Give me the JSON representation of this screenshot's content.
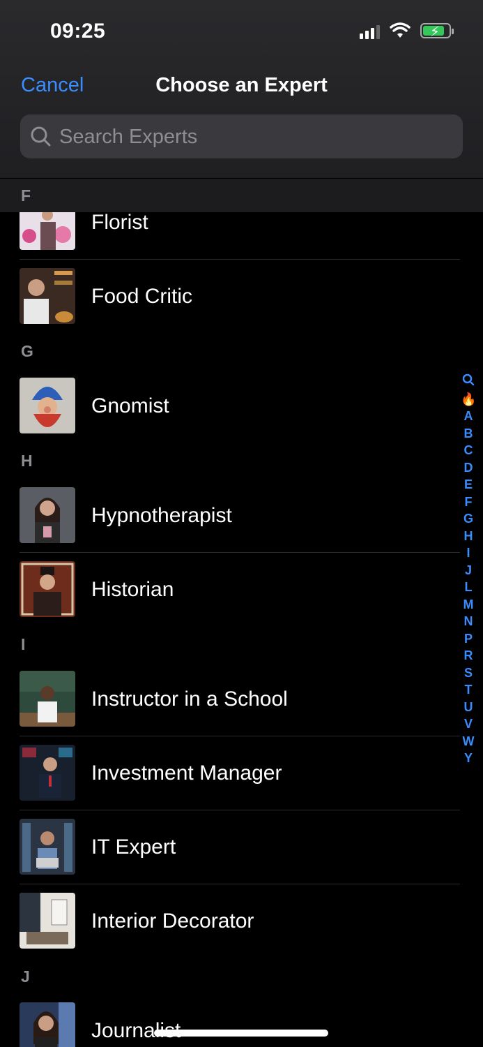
{
  "status_bar": {
    "time": "09:25"
  },
  "nav": {
    "cancel_label": "Cancel",
    "title": "Choose an Expert"
  },
  "search": {
    "placeholder": "Search Experts"
  },
  "sticky_section": "F",
  "sections": [
    {
      "letter": "F",
      "items": [
        "Florist",
        "Food Critic"
      ]
    },
    {
      "letter": "G",
      "items": [
        "Gnomist"
      ]
    },
    {
      "letter": "H",
      "items": [
        "Hypnotherapist",
        "Historian"
      ]
    },
    {
      "letter": "I",
      "items": [
        "Instructor in a School",
        "Investment Manager",
        "IT Expert",
        "Interior Decorator"
      ]
    },
    {
      "letter": "J",
      "items": [
        "Journalist"
      ]
    }
  ],
  "list": {
    "g": "G",
    "h": "H",
    "i": "I",
    "j": "J",
    "florist": "Florist",
    "food_critic": "Food Critic",
    "gnomist": "Gnomist",
    "hypnotherapist": "Hypnotherapist",
    "historian": "Historian",
    "instructor": "Instructor in a School",
    "investment_manager": "Investment Manager",
    "it_expert": "IT Expert",
    "interior_decorator": "Interior Decorator",
    "journalist": "Journalist"
  },
  "index_letters": [
    "A",
    "B",
    "C",
    "D",
    "E",
    "F",
    "G",
    "H",
    "I",
    "J",
    "L",
    "M",
    "N",
    "P",
    "R",
    "S",
    "T",
    "U",
    "V",
    "W",
    "Y"
  ],
  "colors": {
    "accent": "#3a8dff",
    "background": "#000000",
    "header": "#2a2a2d",
    "section_bar": "#1c1c1e"
  }
}
